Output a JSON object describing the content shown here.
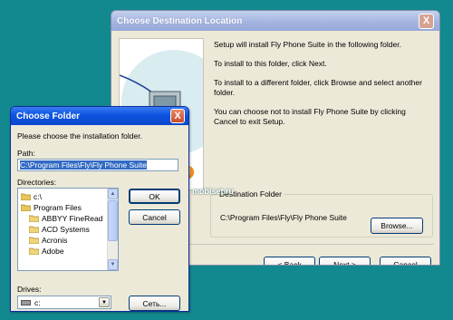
{
  "destination_dialog": {
    "title": "Choose Destination Location",
    "close_glyph": "X",
    "paragraphs": [
      "Setup will install Fly Phone Suite in the following folder.",
      "To install to this folder, click Next.",
      "To install to a different folder, click Browse and select another folder.",
      "You can choose not to install Fly Phone Suite by clicking Cancel to exit Setup."
    ],
    "destination_group_label": "Destination Folder",
    "destination_path": "C:\\Program Files\\Fly\\Fly Phone Suite",
    "browse_label": "Browse...",
    "back": {
      "mnemonic": "B",
      "rest": "ack"
    },
    "next": {
      "mnemonic": "N",
      "rest": "ext"
    },
    "cancel_label": "Cancel"
  },
  "choose_folder_dialog": {
    "title": "Choose Folder",
    "close_glyph": "X",
    "prompt": "Please choose the installation folder.",
    "path_label": "Path:",
    "path_value": "C:\\Program Files\\Fly\\Fly Phone Suite",
    "directories_label": "Directories:",
    "directories": [
      "c:\\",
      "Program Files",
      "ABBYY FineRead",
      "ACD Systems",
      "Acronis",
      "Adobe"
    ],
    "ok_label": "OK",
    "cancel_label": "Cancel",
    "drives_label": "Drives:",
    "drive_value": "c:",
    "network_label": "Сеть..."
  },
  "watermark": "mobiset.ru",
  "colors": {
    "desktop": "#12888f",
    "dialog_face": "#ece9d8",
    "active_title": "#0d54e0",
    "inactive_title": "#a5b5e0",
    "selection": "#316ac5",
    "logo": "#f39019"
  }
}
